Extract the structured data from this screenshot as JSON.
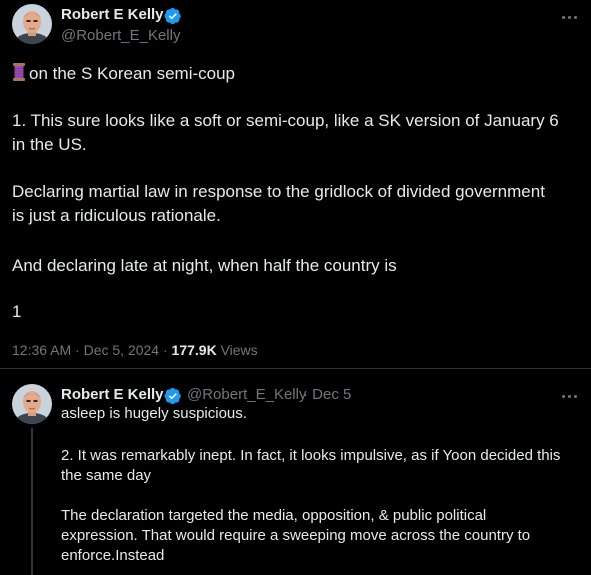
{
  "colors": {
    "background": "#000000",
    "text": "#e7e9ea",
    "secondary": "#71767b",
    "verified": "#1d9bf0",
    "divider": "#2f3336"
  },
  "main_tweet": {
    "author_name": "Robert E Kelly",
    "author_handle": "@Robert_E_Kelly",
    "verified_icon": "verified-badge-icon",
    "more_icon": "more-options-icon",
    "thread_emoji": "thread-spool-emoji",
    "line1_text": "on the S Korean semi-coup",
    "para1_line1": "1. This sure looks like a soft or semi-coup, like a SK version of January 6",
    "para1_line2": "in the US.",
    "para2_line1": "Declaring martial law in response to the gridlock of divided government",
    "para2_line2": "is just a ridiculous rationale.",
    "para3_line1": "And declaring late at night, when half the country is",
    "page_number": "1",
    "timestamp": "12:36 AM · Dec 5, 2024 · ",
    "views_count": "177.9K",
    "views_label": " Views"
  },
  "reply_tweet": {
    "author_name": "Robert E Kelly",
    "author_handle": "@Robert_E_Kelly",
    "date": "· Dec 5",
    "verified_icon": "verified-badge-icon",
    "more_icon": "more-options-icon",
    "line1": "asleep is hugely suspicious.",
    "para2_line1": "2. It was remarkably inept. In fact, it looks impulsive, as if Yoon decided this",
    "para2_line2": "the same day",
    "para3_line1": "The declaration targeted the media, opposition, & public political",
    "para3_line2": "expression. That would require a sweeping move across the country to",
    "para3_line3": "enforce.Instead"
  }
}
